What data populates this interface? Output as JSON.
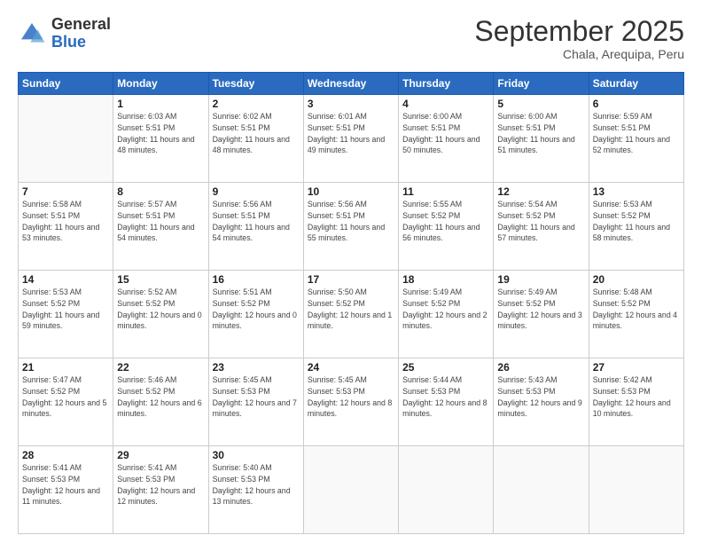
{
  "header": {
    "logo_general": "General",
    "logo_blue": "Blue",
    "title": "September 2025",
    "subtitle": "Chala, Arequipa, Peru"
  },
  "calendar": {
    "days": [
      "Sunday",
      "Monday",
      "Tuesday",
      "Wednesday",
      "Thursday",
      "Friday",
      "Saturday"
    ],
    "rows": [
      [
        {
          "date": "",
          "sunrise": "",
          "sunset": "",
          "daylight": ""
        },
        {
          "date": "1",
          "sunrise": "Sunrise: 6:03 AM",
          "sunset": "Sunset: 5:51 PM",
          "daylight": "Daylight: 11 hours and 48 minutes."
        },
        {
          "date": "2",
          "sunrise": "Sunrise: 6:02 AM",
          "sunset": "Sunset: 5:51 PM",
          "daylight": "Daylight: 11 hours and 48 minutes."
        },
        {
          "date": "3",
          "sunrise": "Sunrise: 6:01 AM",
          "sunset": "Sunset: 5:51 PM",
          "daylight": "Daylight: 11 hours and 49 minutes."
        },
        {
          "date": "4",
          "sunrise": "Sunrise: 6:00 AM",
          "sunset": "Sunset: 5:51 PM",
          "daylight": "Daylight: 11 hours and 50 minutes."
        },
        {
          "date": "5",
          "sunrise": "Sunrise: 6:00 AM",
          "sunset": "Sunset: 5:51 PM",
          "daylight": "Daylight: 11 hours and 51 minutes."
        },
        {
          "date": "6",
          "sunrise": "Sunrise: 5:59 AM",
          "sunset": "Sunset: 5:51 PM",
          "daylight": "Daylight: 11 hours and 52 minutes."
        }
      ],
      [
        {
          "date": "7",
          "sunrise": "Sunrise: 5:58 AM",
          "sunset": "Sunset: 5:51 PM",
          "daylight": "Daylight: 11 hours and 53 minutes."
        },
        {
          "date": "8",
          "sunrise": "Sunrise: 5:57 AM",
          "sunset": "Sunset: 5:51 PM",
          "daylight": "Daylight: 11 hours and 54 minutes."
        },
        {
          "date": "9",
          "sunrise": "Sunrise: 5:56 AM",
          "sunset": "Sunset: 5:51 PM",
          "daylight": "Daylight: 11 hours and 54 minutes."
        },
        {
          "date": "10",
          "sunrise": "Sunrise: 5:56 AM",
          "sunset": "Sunset: 5:51 PM",
          "daylight": "Daylight: 11 hours and 55 minutes."
        },
        {
          "date": "11",
          "sunrise": "Sunrise: 5:55 AM",
          "sunset": "Sunset: 5:52 PM",
          "daylight": "Daylight: 11 hours and 56 minutes."
        },
        {
          "date": "12",
          "sunrise": "Sunrise: 5:54 AM",
          "sunset": "Sunset: 5:52 PM",
          "daylight": "Daylight: 11 hours and 57 minutes."
        },
        {
          "date": "13",
          "sunrise": "Sunrise: 5:53 AM",
          "sunset": "Sunset: 5:52 PM",
          "daylight": "Daylight: 11 hours and 58 minutes."
        }
      ],
      [
        {
          "date": "14",
          "sunrise": "Sunrise: 5:53 AM",
          "sunset": "Sunset: 5:52 PM",
          "daylight": "Daylight: 11 hours and 59 minutes."
        },
        {
          "date": "15",
          "sunrise": "Sunrise: 5:52 AM",
          "sunset": "Sunset: 5:52 PM",
          "daylight": "Daylight: 12 hours and 0 minutes."
        },
        {
          "date": "16",
          "sunrise": "Sunrise: 5:51 AM",
          "sunset": "Sunset: 5:52 PM",
          "daylight": "Daylight: 12 hours and 0 minutes."
        },
        {
          "date": "17",
          "sunrise": "Sunrise: 5:50 AM",
          "sunset": "Sunset: 5:52 PM",
          "daylight": "Daylight: 12 hours and 1 minute."
        },
        {
          "date": "18",
          "sunrise": "Sunrise: 5:49 AM",
          "sunset": "Sunset: 5:52 PM",
          "daylight": "Daylight: 12 hours and 2 minutes."
        },
        {
          "date": "19",
          "sunrise": "Sunrise: 5:49 AM",
          "sunset": "Sunset: 5:52 PM",
          "daylight": "Daylight: 12 hours and 3 minutes."
        },
        {
          "date": "20",
          "sunrise": "Sunrise: 5:48 AM",
          "sunset": "Sunset: 5:52 PM",
          "daylight": "Daylight: 12 hours and 4 minutes."
        }
      ],
      [
        {
          "date": "21",
          "sunrise": "Sunrise: 5:47 AM",
          "sunset": "Sunset: 5:52 PM",
          "daylight": "Daylight: 12 hours and 5 minutes."
        },
        {
          "date": "22",
          "sunrise": "Sunrise: 5:46 AM",
          "sunset": "Sunset: 5:52 PM",
          "daylight": "Daylight: 12 hours and 6 minutes."
        },
        {
          "date": "23",
          "sunrise": "Sunrise: 5:45 AM",
          "sunset": "Sunset: 5:53 PM",
          "daylight": "Daylight: 12 hours and 7 minutes."
        },
        {
          "date": "24",
          "sunrise": "Sunrise: 5:45 AM",
          "sunset": "Sunset: 5:53 PM",
          "daylight": "Daylight: 12 hours and 8 minutes."
        },
        {
          "date": "25",
          "sunrise": "Sunrise: 5:44 AM",
          "sunset": "Sunset: 5:53 PM",
          "daylight": "Daylight: 12 hours and 8 minutes."
        },
        {
          "date": "26",
          "sunrise": "Sunrise: 5:43 AM",
          "sunset": "Sunset: 5:53 PM",
          "daylight": "Daylight: 12 hours and 9 minutes."
        },
        {
          "date": "27",
          "sunrise": "Sunrise: 5:42 AM",
          "sunset": "Sunset: 5:53 PM",
          "daylight": "Daylight: 12 hours and 10 minutes."
        }
      ],
      [
        {
          "date": "28",
          "sunrise": "Sunrise: 5:41 AM",
          "sunset": "Sunset: 5:53 PM",
          "daylight": "Daylight: 12 hours and 11 minutes."
        },
        {
          "date": "29",
          "sunrise": "Sunrise: 5:41 AM",
          "sunset": "Sunset: 5:53 PM",
          "daylight": "Daylight: 12 hours and 12 minutes."
        },
        {
          "date": "30",
          "sunrise": "Sunrise: 5:40 AM",
          "sunset": "Sunset: 5:53 PM",
          "daylight": "Daylight: 12 hours and 13 minutes."
        },
        {
          "date": "",
          "sunrise": "",
          "sunset": "",
          "daylight": ""
        },
        {
          "date": "",
          "sunrise": "",
          "sunset": "",
          "daylight": ""
        },
        {
          "date": "",
          "sunrise": "",
          "sunset": "",
          "daylight": ""
        },
        {
          "date": "",
          "sunrise": "",
          "sunset": "",
          "daylight": ""
        }
      ]
    ]
  }
}
